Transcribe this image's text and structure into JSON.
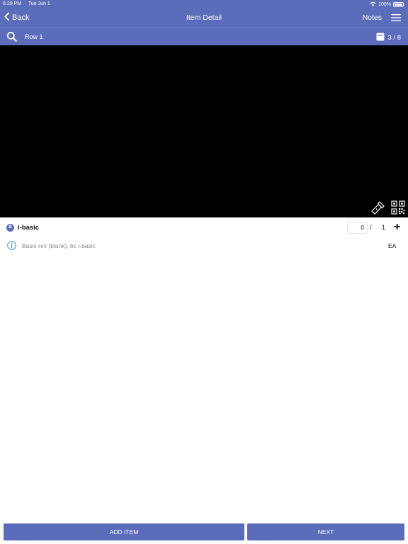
{
  "status_bar": {
    "time": "6:29 PM",
    "date": "Tue Jun 1",
    "battery": "100%"
  },
  "nav": {
    "back_label": "Back",
    "title": "Item Detail",
    "notes_label": "Notes"
  },
  "subbar": {
    "row_label": "Row 1",
    "page_indicator": "3 / 8"
  },
  "item": {
    "badge": "B",
    "name": "i-basic",
    "qty_value": "0",
    "qty_separator": "/",
    "qty_total": "1",
    "plus_label": "+",
    "description": "Basic rev (blank), bc i-basic",
    "unit": "EA"
  },
  "footer": {
    "add_item_label": "ADD ITEM",
    "next_label": "NEXT"
  },
  "colors": {
    "brand": "#5b6cbb",
    "camera_bg": "#000000"
  },
  "icons": [
    "chevron-left-icon",
    "menu-icon",
    "search-icon",
    "box-icon",
    "flashlight-icon",
    "qr-code-icon",
    "info-icon",
    "wifi-icon",
    "battery-icon"
  ]
}
